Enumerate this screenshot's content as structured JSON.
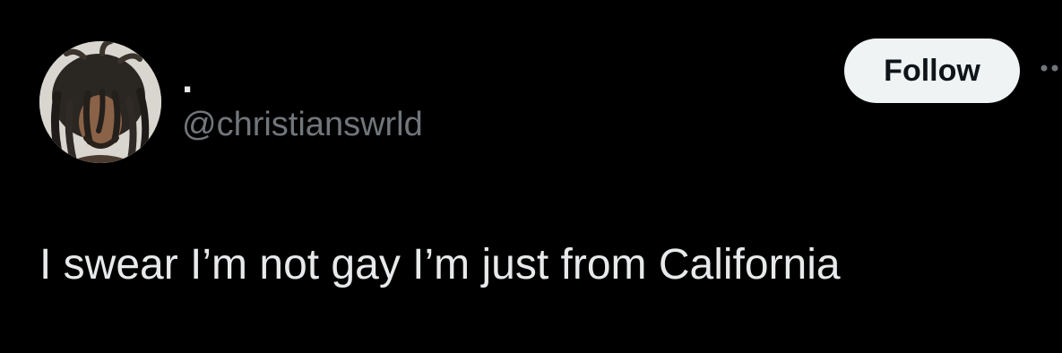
{
  "tweet": {
    "author": {
      "display_name": ".",
      "handle": "@christianswrld",
      "avatar_icon": "profile-photo"
    },
    "follow_label": "Follow",
    "more_icon": "more-horizontal-icon",
    "text": "I swear I’m not gay I’m just from California"
  },
  "colors": {
    "background": "#000000",
    "primary_text": "#e7e9ea",
    "secondary_text": "#71767b",
    "follow_bg": "#eff3f4",
    "follow_text": "#0f1419"
  }
}
